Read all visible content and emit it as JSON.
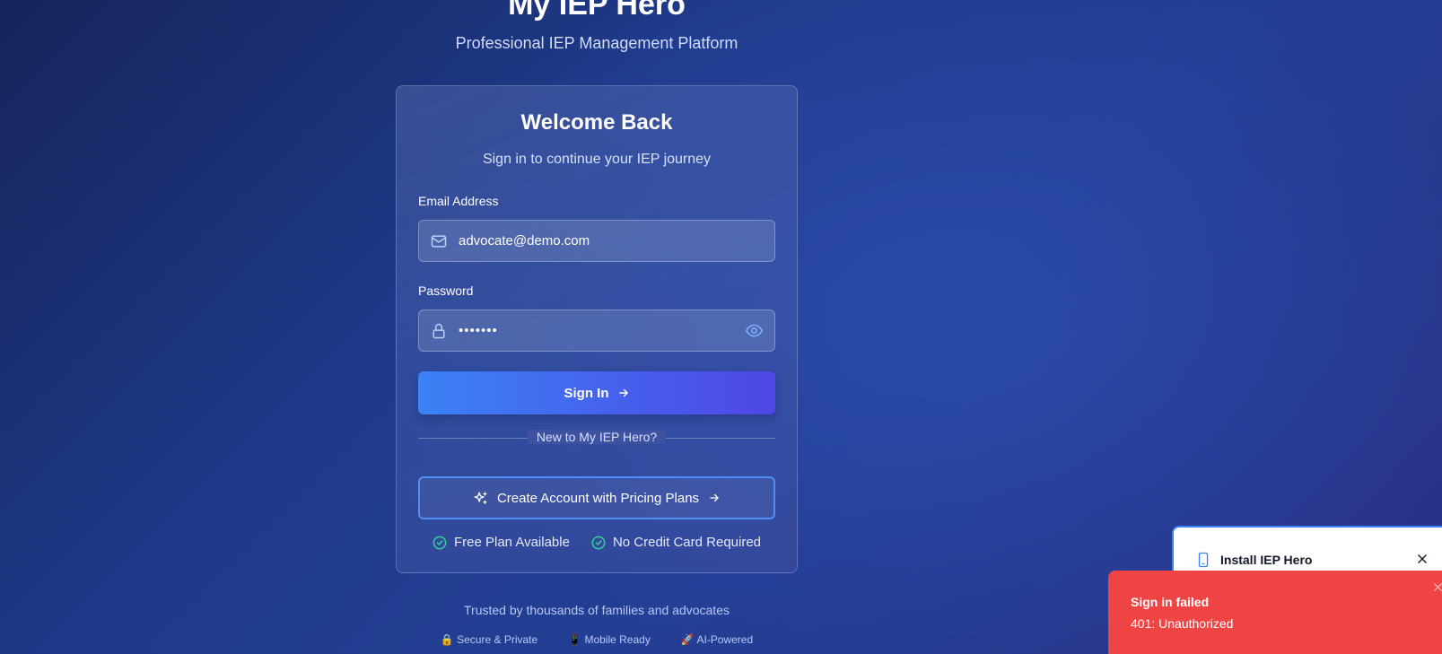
{
  "brand": {
    "title": "My IEP Hero",
    "subtitle": "Professional IEP Management Platform"
  },
  "login": {
    "title": "Welcome Back",
    "subtitle": "Sign in to continue your IEP journey",
    "email_label": "Email Address",
    "email_value": "advocate@demo.com",
    "password_label": "Password",
    "password_value": "•••••••",
    "sign_in_label": "Sign In",
    "divider_text": "New to My IEP Hero?",
    "create_label": "Create Account with Pricing Plans",
    "perks": [
      "Free Plan Available",
      "No Credit Card Required"
    ]
  },
  "footer": {
    "trusted": "Trusted by thousands of families and advocates",
    "badges": [
      "🔒 Secure & Private",
      "📱 Mobile Ready",
      "🚀 AI-Powered"
    ]
  },
  "install_prompt": {
    "title": "Install IEP Hero"
  },
  "toast": {
    "title": "Sign in failed",
    "message": "401: Unauthorized"
  },
  "colors": {
    "primary": "#3b82f6",
    "accent": "#4f46e5",
    "error": "#ef4444",
    "success": "#34d399"
  },
  "icons": [
    "mail-icon",
    "lock-icon",
    "eye-icon",
    "arrow-right-icon",
    "sparkles-icon",
    "check-circle-icon",
    "smartphone-icon",
    "close-icon"
  ]
}
